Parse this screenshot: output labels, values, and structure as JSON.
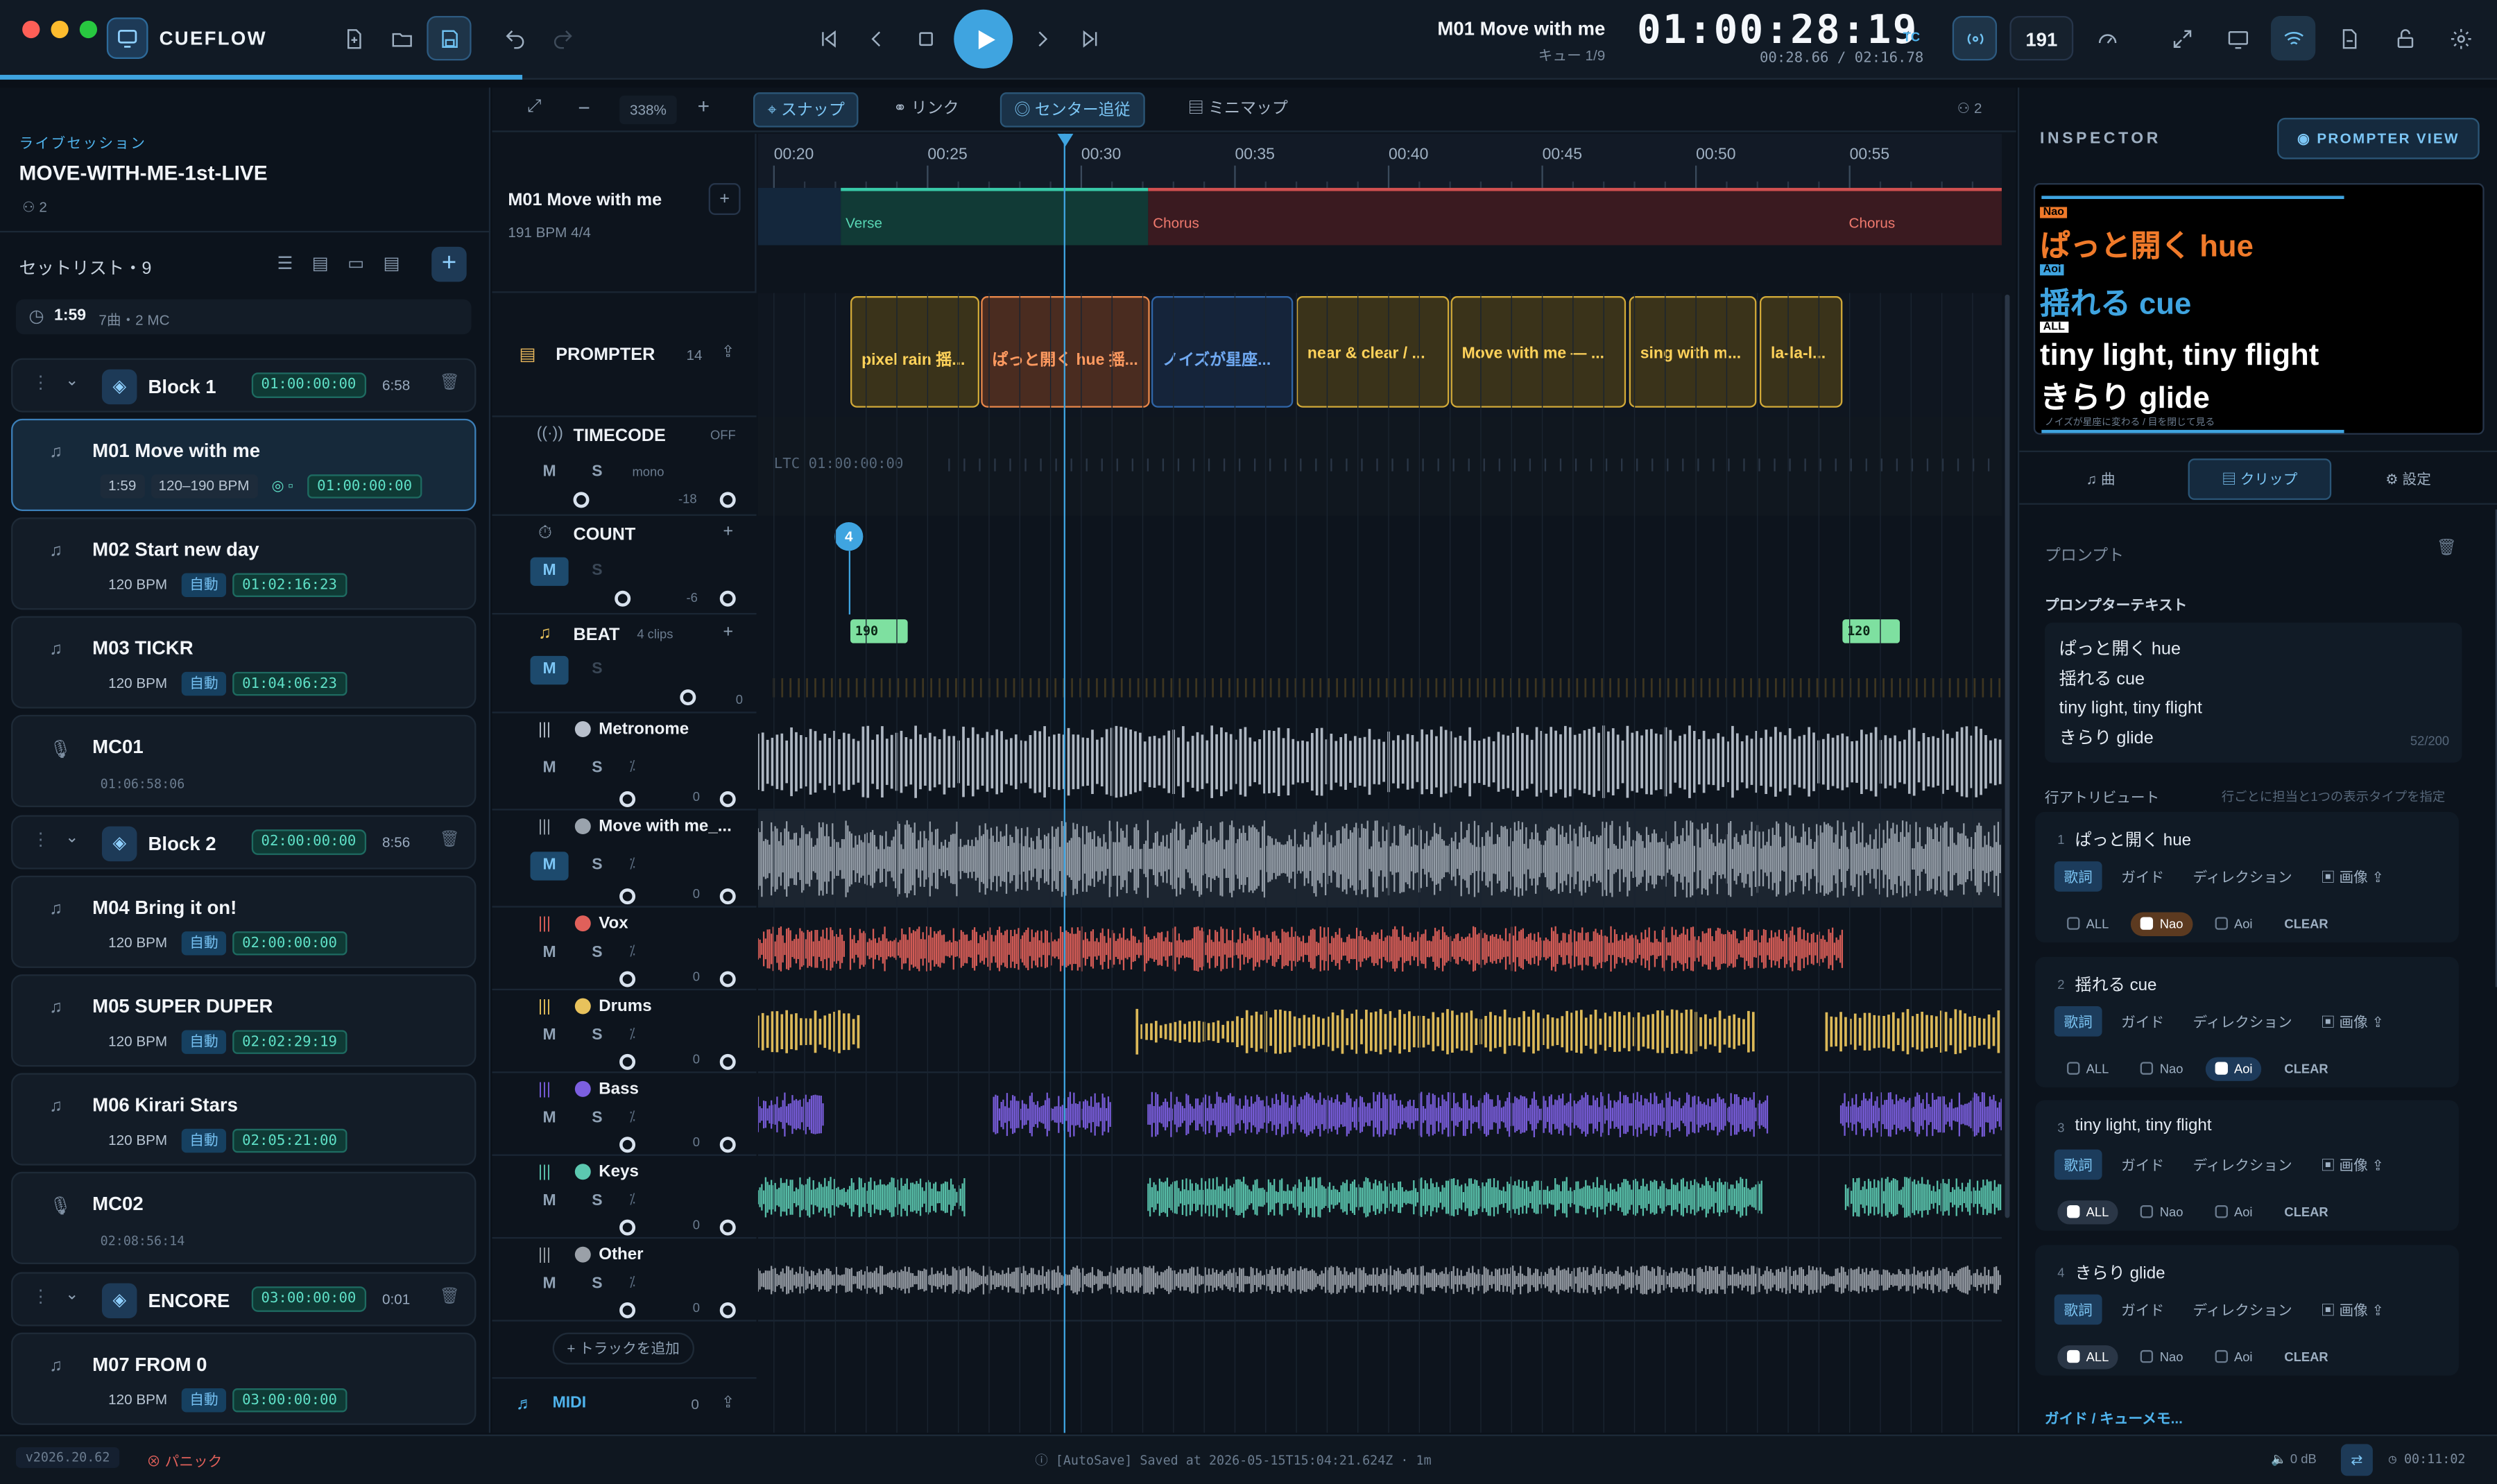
{
  "app": {
    "name": "CUEFLOW"
  },
  "transport": {
    "song": "M01 Move with me",
    "cue": "キュー 1/9",
    "timecode": "01:00:28:19",
    "tc_label": "TC",
    "elapsed": "00:28.66 / 02:16.78",
    "bpm": "191"
  },
  "tools": {
    "zoom": "338%",
    "snap": "スナップ",
    "link": "リンク",
    "center": "センター追従",
    "minimap": "ミニマップ",
    "users": "2"
  },
  "session": {
    "label": "ライブセッション",
    "name": "MOVE-WITH-ME-1st-LIVE",
    "members": "2",
    "setlist": "セットリスト・9",
    "duration": "1:59",
    "duration_meta": "7曲・2 MC"
  },
  "blocks": [
    {
      "name": "Block 1",
      "tc": "01:00:00:00",
      "len": "6:58"
    },
    {
      "name": "Block 2",
      "tc": "02:00:00:00",
      "len": "8:56"
    },
    {
      "name": "ENCORE",
      "tc": "03:00:00:00",
      "len": "0:01"
    }
  ],
  "songs": [
    {
      "name": "M01 Move with me",
      "len": "1:59",
      "bpm": "120–190 BPM",
      "tc": "01:00:00:00"
    },
    {
      "name": "M02 Start new day",
      "bpm": "120 BPM",
      "auto": "自動",
      "tc": "01:02:16:23"
    },
    {
      "name": "M03 TICKR",
      "bpm": "120 BPM",
      "auto": "自動",
      "tc": "01:04:06:23"
    },
    {
      "name": "MC01",
      "tc": "01:06:58:06"
    },
    {
      "name": "M04 Bring it on!",
      "bpm": "120 BPM",
      "auto": "自動",
      "tc": "02:00:00:00"
    },
    {
      "name": "M05 SUPER DUPER",
      "bpm": "120 BPM",
      "auto": "自動",
      "tc": "02:02:29:19"
    },
    {
      "name": "M06 Kirari Stars",
      "bpm": "120 BPM",
      "auto": "自動",
      "tc": "02:05:21:00"
    },
    {
      "name": "MC02",
      "tc": "02:08:56:14"
    },
    {
      "name": "M07 FROM 0",
      "bpm": "120 BPM",
      "auto": "自動",
      "tc": "03:00:00:00"
    }
  ],
  "timeline": {
    "song": "M01 Move with me",
    "meta": "191 BPM  4/4",
    "ticks": [
      "00:20",
      "00:25",
      "00:30",
      "00:35",
      "00:40",
      "00:45",
      "00:50",
      "00:55"
    ],
    "sections": [
      "Verse",
      "Chorus",
      "Chorus"
    ]
  },
  "tracks": {
    "prompter": {
      "name": "PROMPTER",
      "count": "14"
    },
    "timecode": {
      "name": "TIMECODE",
      "state": "OFF",
      "mono": "mono",
      "gain": "-18",
      "ltc": "LTC 01:00:00:00"
    },
    "count": {
      "name": "COUNT",
      "gain": "-6",
      "marker": "4"
    },
    "beat": {
      "name": "BEAT",
      "clips": "4 clips",
      "gain": "0",
      "tempo1": "190",
      "tempo2": "120"
    },
    "metronome": "Metronome",
    "move": "Move with me_...",
    "vox": "Vox",
    "drums": "Drums",
    "bass": "Bass",
    "keys": "Keys",
    "other": "Other",
    "add": "+ トラックを追加",
    "midi": "MIDI",
    "midi_count": "0",
    "zero": "0",
    "m": "M",
    "s": "S"
  },
  "clips": [
    "pixel rain 揺...",
    "ぱっと開く hue 揺...",
    "ノイズが星座...",
    "near & clear / ...",
    "Move with me — ...",
    "sing with m...",
    "la-la-l..."
  ],
  "inspector": {
    "title": "INSPECTOR",
    "prompter_view": "PROMPTER VIEW",
    "tab_song": "曲",
    "tab_clip": "クリップ",
    "tab_settings": "設定",
    "section": "プロンプト",
    "text_label": "プロンプターテキスト",
    "lines": [
      "ぱっと開く hue",
      "揺れる cue",
      "tiny light, tiny flight",
      "きらり glide"
    ],
    "counter": "52/200",
    "attr_title": "行アトリビュート",
    "attr_hint": "行ごとに担当と1つの表示タイプを指定",
    "guide": "ガイド / キューメモ...",
    "preview": {
      "t1": "Nao",
      "l1": "ぱっと開く hue",
      "t2": "Aoi",
      "l2": "揺れる cue",
      "t3": "ALL",
      "l3": "tiny light, tiny flight",
      "l4": "きらり glide",
      "sub": "ノイズが星座に変わる / 目を閉じて見る"
    }
  },
  "attrs": [
    {
      "n": "1",
      "text": "ぱっと開く hue",
      "sel": "Nao"
    },
    {
      "n": "2",
      "text": "揺れる cue",
      "sel": "Aoi"
    },
    {
      "n": "3",
      "text": "tiny light, tiny flight",
      "sel": "ALL"
    },
    {
      "n": "4",
      "text": "きらり glide",
      "sel": "ALL"
    }
  ],
  "attr_labels": {
    "lyric": "歌詞",
    "guide": "ガイド",
    "direction": "ディレクション",
    "image": "画像",
    "all": "ALL",
    "nao": "Nao",
    "aoi": "Aoi",
    "clear": "CLEAR"
  },
  "status": {
    "version": "v2026.20.62",
    "panic": "パニック",
    "autosave": "[AutoSave] Saved at 2026-05-15T15:04:21.624Z · 1m",
    "db": "0 dB",
    "clock": "00:11:02"
  },
  "colors": {
    "accent": "#3fa4e0",
    "teal": "#43d1b8",
    "vox": "#e0605a",
    "drums": "#e8c25c",
    "bass": "#7c5fe0",
    "keys": "#5cc8b0",
    "other": "#9aa0a8",
    "metro": "#b8c0cc"
  }
}
